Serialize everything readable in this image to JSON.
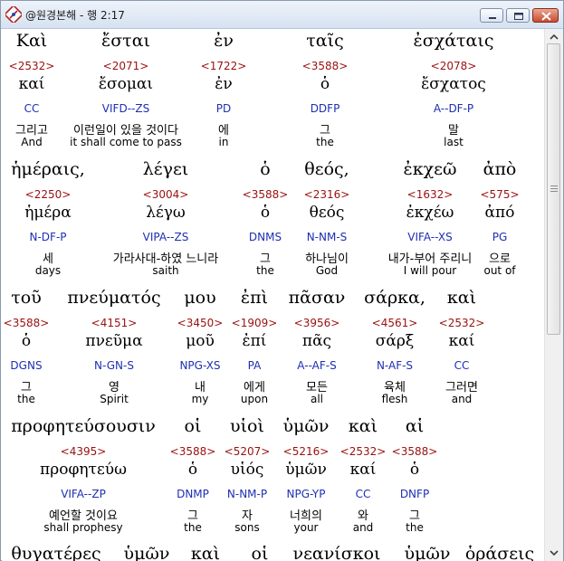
{
  "window": {
    "title": "@원경본해 - 행 2:17",
    "minimize_icon": "minimize-icon",
    "maximize_icon": "maximize-icon",
    "close_icon": "close-icon",
    "app_icon": "app-logo-icon"
  },
  "colors": {
    "number": "#9a1010",
    "morph": "#1d2fb2",
    "text": "#000000"
  },
  "rows": [
    {
      "words": [
        {
          "greek": "Καὶ",
          "num": "<2532>",
          "lemma": "καί",
          "morph": "CC",
          "kor": "그리고",
          "eng": "And"
        },
        {
          "greek": "ἔσται",
          "num": "<2071>",
          "lemma": "ἔσομαι",
          "morph": "VIFD--ZS",
          "kor": "이런일이 있을 것이다",
          "eng": "it shall come to pass"
        },
        {
          "greek": "ἐν",
          "num": "<1722>",
          "lemma": "ἐν",
          "morph": "PD",
          "kor": "에",
          "eng": "in"
        },
        {
          "greek": "ταῖς",
          "num": "<3588>",
          "lemma": "ὁ",
          "morph": "DDFP",
          "kor": "그",
          "eng": "the"
        },
        {
          "greek": "ἐσχάταις",
          "num": "<2078>",
          "lemma": "ἔσχατος",
          "morph": "A--DF-P",
          "kor": "말",
          "eng": "last"
        }
      ]
    },
    {
      "words": [
        {
          "greek": "ἡμέραις,",
          "num": "<2250>",
          "lemma": "ἡμέρα",
          "morph": "N-DF-P",
          "kor": "세",
          "eng": "days"
        },
        {
          "greek": "λέγει",
          "num": "<3004>",
          "lemma": "λέγω",
          "morph": "VIPA--ZS",
          "kor": "가라사대-하였 느니라",
          "eng": "saith"
        },
        {
          "greek": "ὁ",
          "num": "<3588>",
          "lemma": "ὁ",
          "morph": "DNMS",
          "kor": "그",
          "eng": "the"
        },
        {
          "greek": "θεός,",
          "num": "<2316>",
          "lemma": "θεός",
          "morph": "N-NM-S",
          "kor": "하나님이",
          "eng": "God"
        },
        {
          "greek": "ἐκχεῶ",
          "num": "<1632>",
          "lemma": "ἐκχέω",
          "morph": "VIFA--XS",
          "kor": "내가-부어 주리니",
          "eng": "I will pour"
        },
        {
          "greek": "ἀπὸ",
          "num": "<575>",
          "lemma": "ἀπό",
          "morph": "PG",
          "kor": "으로",
          "eng": "out of"
        }
      ]
    },
    {
      "words": [
        {
          "greek": "τοῦ",
          "num": "<3588>",
          "lemma": "ὁ",
          "morph": "DGNS",
          "kor": "그",
          "eng": "the"
        },
        {
          "greek": "πνεύματός",
          "num": "<4151>",
          "lemma": "πνεῦμα",
          "morph": "N-GN-S",
          "kor": "영",
          "eng": "Spirit"
        },
        {
          "greek": "μου",
          "num": "<3450>",
          "lemma": "μοῦ",
          "morph": "NPG-XS",
          "kor": "내",
          "eng": "my"
        },
        {
          "greek": "ἐπὶ",
          "num": "<1909>",
          "lemma": "ἐπί",
          "morph": "PA",
          "kor": "에게",
          "eng": "upon"
        },
        {
          "greek": "πᾶσαν",
          "num": "<3956>",
          "lemma": "πᾶς",
          "morph": "A--AF-S",
          "kor": "모든",
          "eng": "all"
        },
        {
          "greek": "σάρκα,",
          "num": "<4561>",
          "lemma": "σάρξ",
          "morph": "N-AF-S",
          "kor": "육체",
          "eng": "flesh"
        },
        {
          "greek": "καὶ",
          "num": "<2532>",
          "lemma": "καί",
          "morph": "CC",
          "kor": "그러면",
          "eng": "and"
        }
      ]
    },
    {
      "words": [
        {
          "greek": "προφητεύσουσιν",
          "num": "<4395>",
          "lemma": "προφητεύω",
          "morph": "VIFA--ZP",
          "kor": "예언할 것이요",
          "eng": "shall prophesy"
        },
        {
          "greek": "οἱ",
          "num": "<3588>",
          "lemma": "ὁ",
          "morph": "DNMP",
          "kor": "그",
          "eng": "the"
        },
        {
          "greek": "υἱοὶ",
          "num": "<5207>",
          "lemma": "υἱός",
          "morph": "N-NM-P",
          "kor": "자",
          "eng": "sons"
        },
        {
          "greek": "ὑμῶν",
          "num": "<5216>",
          "lemma": "ὑμῶν",
          "morph": "NPG-YP",
          "kor": "너희의",
          "eng": "your"
        },
        {
          "greek": "καὶ",
          "num": "<2532>",
          "lemma": "καί",
          "morph": "CC",
          "kor": "와",
          "eng": "and"
        },
        {
          "greek": "αἱ",
          "num": "<3588>",
          "lemma": "ὁ",
          "morph": "DNFP",
          "kor": "그",
          "eng": "the"
        }
      ]
    },
    {
      "words": [
        {
          "greek": "θυγατέρες",
          "num": "",
          "lemma": "",
          "morph": "",
          "kor": "",
          "eng": ""
        },
        {
          "greek": "ὑμῶν",
          "num": "",
          "lemma": "",
          "morph": "",
          "kor": "",
          "eng": ""
        },
        {
          "greek": "καὶ",
          "num": "",
          "lemma": "",
          "morph": "",
          "kor": "",
          "eng": ""
        },
        {
          "greek": "οἱ",
          "num": "",
          "lemma": "",
          "morph": "",
          "kor": "",
          "eng": ""
        },
        {
          "greek": "νεανίσκοι",
          "num": "",
          "lemma": "",
          "morph": "",
          "kor": "",
          "eng": ""
        },
        {
          "greek": "ὑμῶν",
          "num": "",
          "lemma": "",
          "morph": "",
          "kor": "",
          "eng": ""
        },
        {
          "greek": "ὁράσεις",
          "num": "",
          "lemma": "",
          "morph": "",
          "kor": "",
          "eng": ""
        }
      ]
    }
  ]
}
